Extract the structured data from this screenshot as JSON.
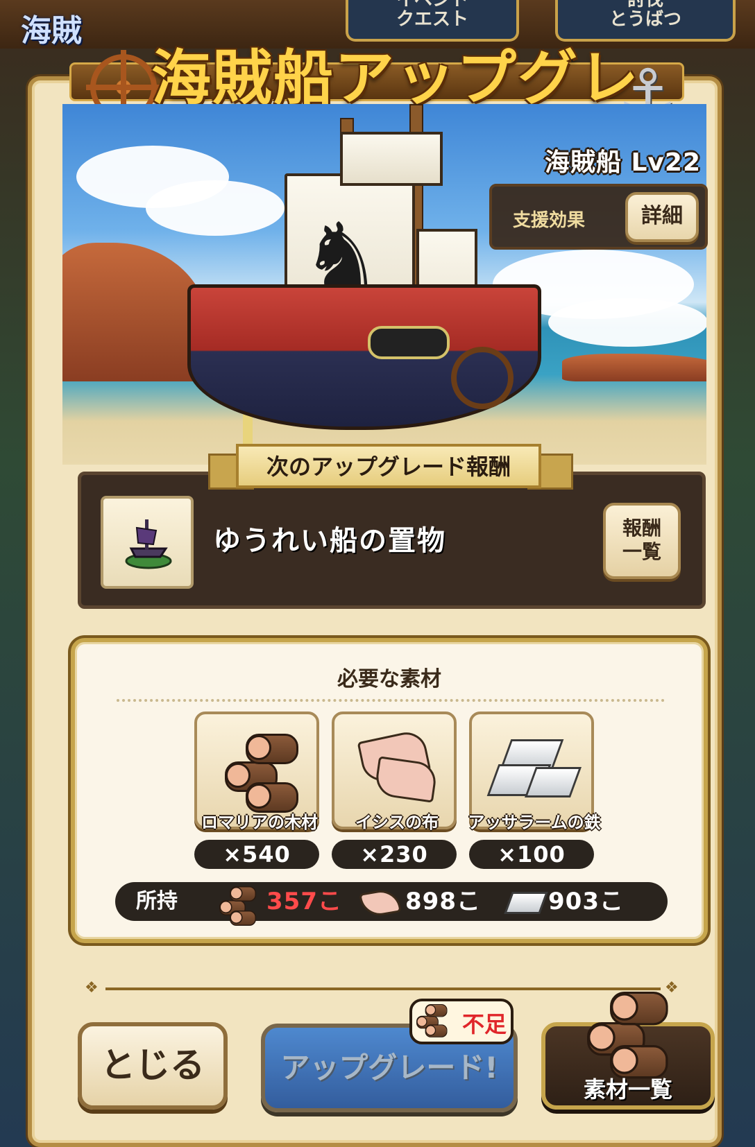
{
  "background": {
    "logo_text": "海賊",
    "tab_quest": "イベント\nクエスト",
    "tab_raid": "討伐\nとうばつ"
  },
  "title": "海賊船アップグレード",
  "ship": {
    "level_label": "海賊船 Lv22",
    "support_label": "支援効果",
    "detail_button": "詳細"
  },
  "reward": {
    "ribbon": "次のアップグレード報酬",
    "item_name": "ゆうれい船の置物",
    "list_button_line1": "報酬",
    "list_button_line2": "一覧"
  },
  "materials": {
    "title": "必要な素材",
    "items": [
      {
        "name": "ロマリアの木材",
        "qty": "×540",
        "icon": "log-icon"
      },
      {
        "name": "イシスの布",
        "qty": "×230",
        "icon": "cloth-icon"
      },
      {
        "name": "アッサラームの鉄",
        "qty": "×100",
        "icon": "ingot-icon"
      }
    ],
    "owned_label": "所持",
    "owned": [
      {
        "value": "357こ",
        "insufficient": true,
        "color": "#ff4b4b"
      },
      {
        "value": "898こ",
        "insufficient": false,
        "color": "#ffffff"
      },
      {
        "value": "903こ",
        "insufficient": false,
        "color": "#ffffff"
      }
    ]
  },
  "buttons": {
    "close": "とじる",
    "upgrade": "アップグレード!",
    "shortage": "不足",
    "material_list": "素材一覧"
  },
  "colors": {
    "accent_gold": "#ffd34a",
    "shortage_red": "#e0262a",
    "upgrade_blue": "#3d7fd1"
  }
}
